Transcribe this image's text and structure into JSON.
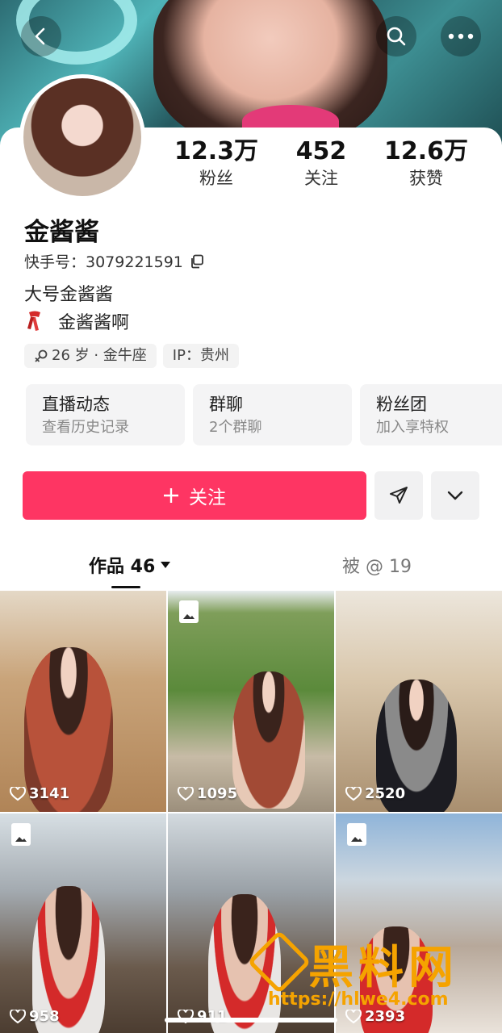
{
  "header": {
    "back_icon": "chevron-left-icon",
    "search_icon": "search-icon",
    "more_icon": "more-dots-icon"
  },
  "profile": {
    "name": "金酱酱",
    "kuaishou_id": "快手号：3079221591",
    "bio_line1": "大号金酱酱",
    "bio_line2": "金酱酱啊",
    "tags": [
      "26 岁 · 金牛座",
      "IP：贵州"
    ]
  },
  "stats": [
    {
      "num": "12.3万",
      "label": "粉丝"
    },
    {
      "num": "452",
      "label": "关注"
    },
    {
      "num": "12.6万",
      "label": "获赞"
    }
  ],
  "cards": [
    {
      "title": "直播动态",
      "sub": "查看历史记录"
    },
    {
      "title": "群聊",
      "sub": "2个群聊"
    },
    {
      "title": "粉丝团",
      "sub": "加入享特权"
    }
  ],
  "actions": {
    "follow_label": "关注",
    "follow_color": "#fe3563"
  },
  "tabs": {
    "works": "作品 46",
    "mentioned": "被 @ 19"
  },
  "videos": [
    {
      "likes": "3141",
      "image_post": false
    },
    {
      "likes": "1095",
      "image_post": true
    },
    {
      "likes": "2520",
      "image_post": false
    },
    {
      "likes": "958",
      "image_post": true
    },
    {
      "likes": "911",
      "image_post": false
    },
    {
      "likes": "2393",
      "image_post": true
    }
  ],
  "watermark": {
    "title": "黑料网",
    "url": "https://hlwe4.com"
  }
}
